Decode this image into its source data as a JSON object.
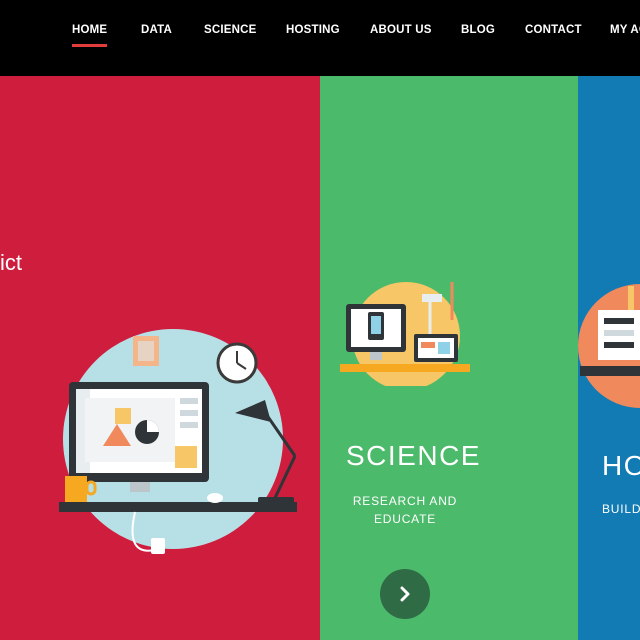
{
  "nav": {
    "items": [
      {
        "label": "HOME",
        "active": true
      },
      {
        "label": "DATA"
      },
      {
        "label": "SCIENCE"
      },
      {
        "label": "HOSTING"
      },
      {
        "label": "ABOUT US"
      },
      {
        "label": "BLOG"
      },
      {
        "label": "CONTACT"
      },
      {
        "label": "MY AC"
      }
    ]
  },
  "data_panel": {
    "partial_text": "ict",
    "color": "#cf1d3e",
    "illustration": "desktop-computer-workspace"
  },
  "science_panel": {
    "title": "SCIENCE",
    "subtitle_line1": "RESEARCH AND",
    "subtitle_line2": "EDUCATE",
    "color": "#4cba6b",
    "illustration": "devices-on-desk",
    "button_icon": "chevron-right-icon"
  },
  "hosting_panel": {
    "title": "HO",
    "subtitle": "BUILD",
    "color": "#127bb4",
    "illustration": "hosting-tools"
  },
  "colors": {
    "nav_bg": "#000000",
    "active_underline": "#e23b3b",
    "button_bg": "#2f6b45"
  }
}
